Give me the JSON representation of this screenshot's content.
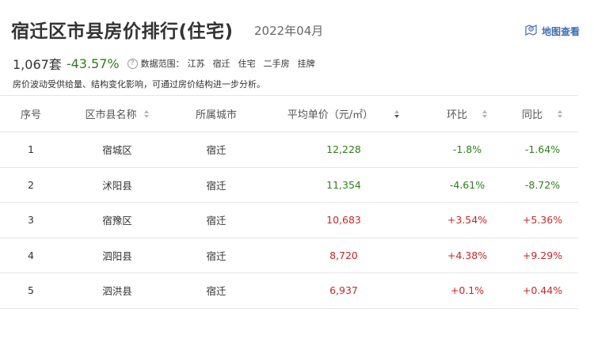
{
  "header": {
    "title": "宿迁区市县房价排行(住宅)",
    "period": "2022年04月",
    "map_link": "地图查看"
  },
  "summary": {
    "count": "1,067套",
    "change": "-43.57%",
    "range_label": "数据范围：",
    "filters": [
      "江苏",
      "宿迁",
      "住宅",
      "二手房",
      "挂牌"
    ],
    "note": "房价波动受供给量、结构变化影响，可通过房价结构进一步分析。"
  },
  "table": {
    "columns": [
      "序号",
      "区市县名称",
      "所属城市",
      "平均单价（元/㎡）",
      "环比",
      "同比"
    ],
    "rows": [
      {
        "rank": "1",
        "name": "宿城区",
        "city": "宿迁",
        "price": "12,228",
        "mom": "-1.8%",
        "yoy": "-1.64%",
        "price_trend": "down",
        "mom_trend": "down",
        "yoy_trend": "down"
      },
      {
        "rank": "2",
        "name": "沭阳县",
        "city": "宿迁",
        "price": "11,354",
        "mom": "-4.61%",
        "yoy": "-8.72%",
        "price_trend": "down",
        "mom_trend": "down",
        "yoy_trend": "down"
      },
      {
        "rank": "3",
        "name": "宿豫区",
        "city": "宿迁",
        "price": "10,683",
        "mom": "+3.54%",
        "yoy": "+5.36%",
        "price_trend": "up",
        "mom_trend": "up",
        "yoy_trend": "up"
      },
      {
        "rank": "4",
        "name": "泗阳县",
        "city": "宿迁",
        "price": "8,720",
        "mom": "+4.38%",
        "yoy": "+9.29%",
        "price_trend": "up",
        "mom_trend": "up",
        "yoy_trend": "up"
      },
      {
        "rank": "5",
        "name": "泗洪县",
        "city": "宿迁",
        "price": "6,937",
        "mom": "+0.1%",
        "yoy": "+0.44%",
        "price_trend": "up",
        "mom_trend": "up",
        "yoy_trend": "up"
      }
    ]
  },
  "colors": {
    "up": "#c62828",
    "down": "#2e7d1b",
    "link": "#3c6fb3"
  }
}
